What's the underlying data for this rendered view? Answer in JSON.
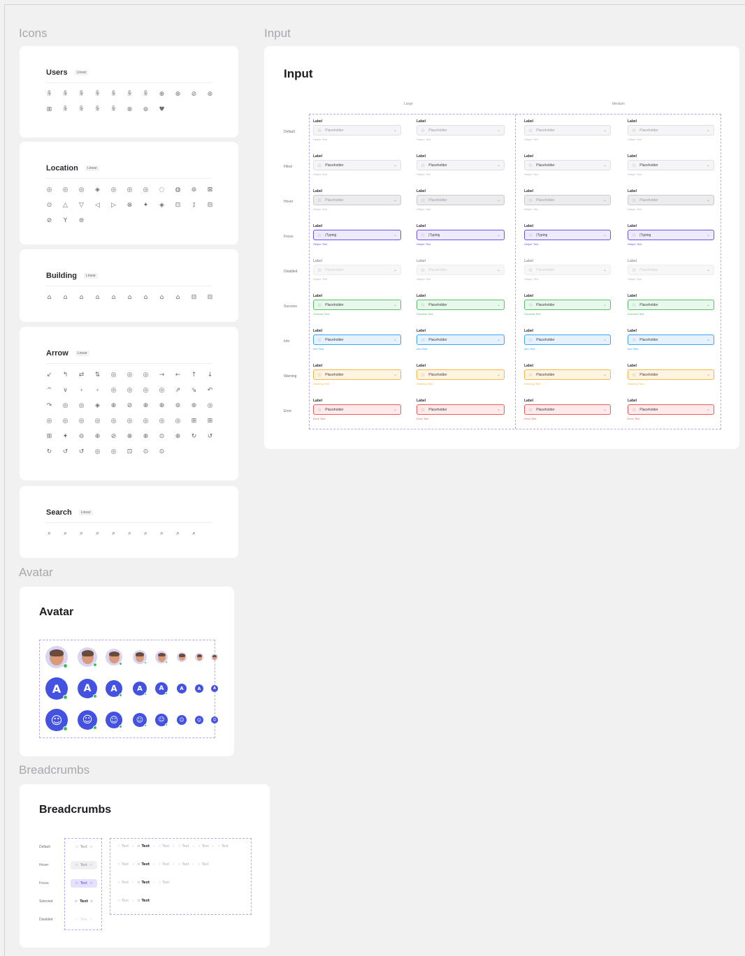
{
  "sections": {
    "icons": "Icons",
    "input": "Input",
    "avatar": "Avatar",
    "breadcrumbs": "Breadcrumbs"
  },
  "icon_groups": [
    {
      "name": "Users",
      "tag": "Linear",
      "icons": [
        "ꆜ",
        "ꆜ",
        "ꆜ",
        "ꆜ",
        "ꆜ",
        "ꆜ",
        "ꆜ",
        "⊕",
        "⊛",
        "⊘",
        "⊚",
        "⊞",
        "ꆜ",
        "ꆜ",
        "ꆜ",
        "ꆜ",
        "⊛",
        "⊚",
        "♥"
      ]
    },
    {
      "name": "Location",
      "tag": "Linear",
      "icons": [
        "◎",
        "◎",
        "◎",
        "◈",
        "◎",
        "◎",
        "◎",
        "◌",
        "◍",
        "⊚",
        "⊠",
        "⊙",
        "△",
        "▽",
        "◁",
        "▷",
        "⊗",
        "✦",
        "◈",
        "⊡",
        "⁒",
        "⊟",
        "⊘",
        "Y",
        "⊜"
      ]
    },
    {
      "name": "Building",
      "tag": "Linear",
      "icons": [
        "⌂",
        "⌂",
        "⌂",
        "⌂",
        "⌂",
        "⌂",
        "⌂",
        "⌂",
        "⌂",
        "⊟",
        "⊟"
      ]
    },
    {
      "name": "Arrow",
      "tag": "Linear",
      "icons": [
        "↙",
        "↰",
        "⇄",
        "⇅",
        "◎",
        "◎",
        "◎",
        "→",
        "←",
        "↑",
        "↓",
        "^",
        "∨",
        "›",
        "‹",
        "◎",
        "◎",
        "◎",
        "◎",
        "⇗",
        "⇘",
        "↶",
        "↷",
        "◎",
        "◎",
        "◈",
        "⊕",
        "⊘",
        "⊕",
        "⊕",
        "⊚",
        "⊛",
        "◎",
        "◎",
        "◎",
        "◎",
        "◎",
        "◎",
        "◎",
        "◎",
        "◎",
        "◎",
        "⊞",
        "⊞",
        "⊞",
        "✦",
        "⊖",
        "⊕",
        "⊘",
        "⊗",
        "⊕",
        "⊙",
        "⊕",
        "↻",
        "↺",
        "↻",
        "↺",
        "↺",
        "◎",
        "◎",
        "⊡",
        "⊙",
        "⊙"
      ]
    },
    {
      "name": "Search",
      "tag": "Linear",
      "icons": [
        "⌕",
        "⌕",
        "⌕",
        "⌕",
        "⌕",
        "⌕",
        "⌕",
        "⌕",
        "⌕",
        "⌕"
      ]
    }
  ],
  "input_card": {
    "title": "Input",
    "sizes": [
      "Large",
      "Medium"
    ],
    "states": [
      "Default",
      "Filled",
      "Hover",
      "Focus",
      "Disabled",
      "Success",
      "Info",
      "Warning",
      "Error"
    ],
    "label": "Label",
    "placeholder": "Placeholder",
    "typing": "|Typing",
    "helper": {
      "Default": "Helper Text",
      "Filled": "Helper Text",
      "Hover": "Helper Text",
      "Focus": "Helper Text",
      "Disabled": "Helper Text",
      "Success": "Success Text",
      "Info": "Info Text",
      "Warning": "Warning Text",
      "Error": "Error Text"
    }
  },
  "avatar_card": {
    "title": "Avatar",
    "letter": "A",
    "smile": "☺",
    "rows": [
      "photo",
      "letter",
      "smile"
    ]
  },
  "breadcrumbs_card": {
    "title": "Breadcrumbs",
    "states": [
      "Default",
      "Hover",
      "Focus",
      "Selected",
      "Disabled"
    ],
    "item_text": "Text",
    "separator": "›",
    "star": "☆",
    "star_filled": "✩"
  },
  "colors": {
    "accent": "#6a52f0",
    "avatar_blue": "#4352e0",
    "online": "#3cc15a",
    "success": "#58c26a",
    "info": "#3da2ef",
    "warning": "#f5b547",
    "error": "#ef5a5a"
  }
}
